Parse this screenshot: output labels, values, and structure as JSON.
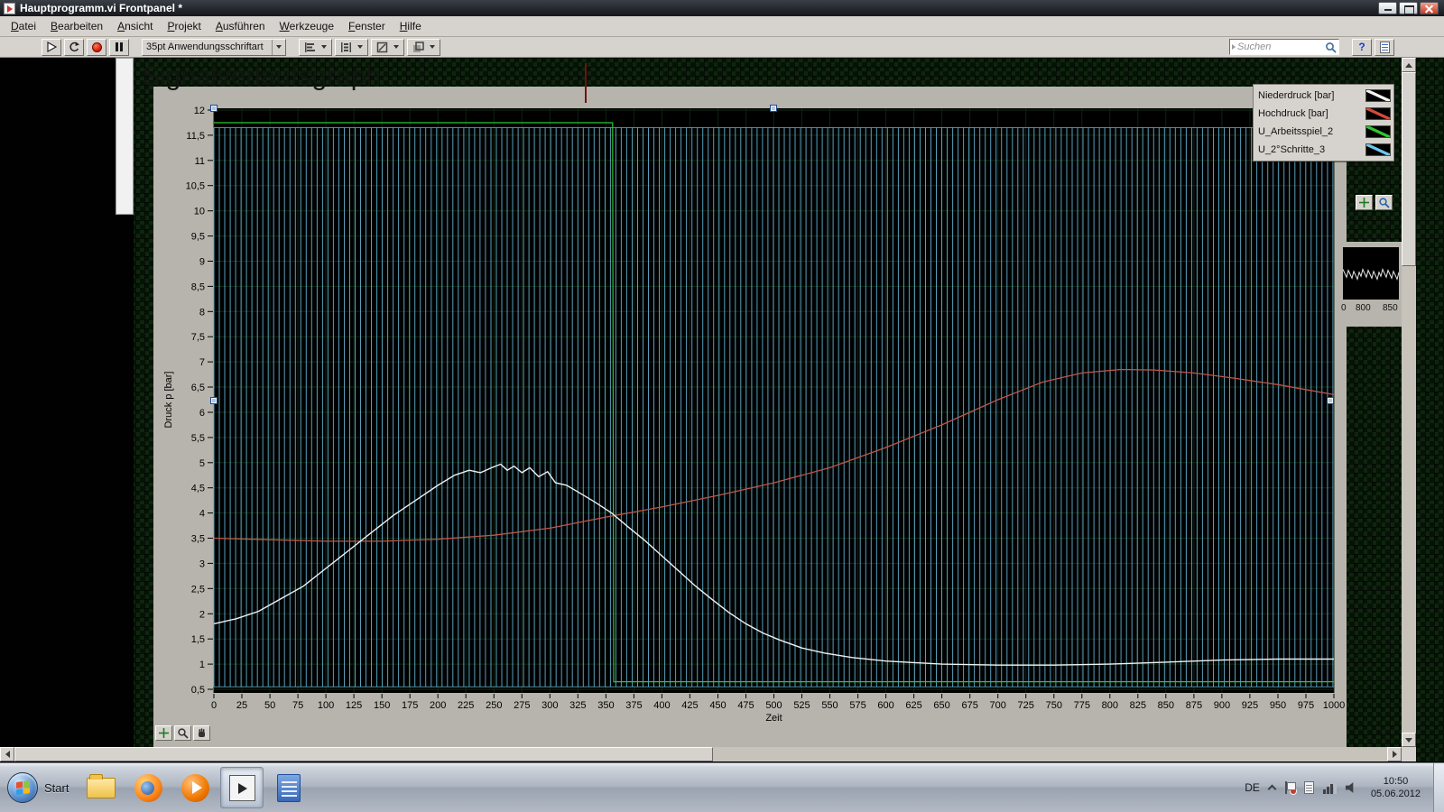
{
  "window": {
    "title": "Hauptprogramm.vi Frontpanel *"
  },
  "menu": {
    "items": [
      "Datei",
      "Bearbeiten",
      "Ansicht",
      "Projekt",
      "Ausführen",
      "Werkzeuge",
      "Fenster",
      "Hilfe"
    ]
  },
  "toolbar": {
    "font_selector": "35pt Anwendungsschriftart",
    "search_placeholder": "Suchen",
    "help_label": "?"
  },
  "graph": {
    "title": "Signalverlaufsgraph",
    "y_axis_label": "Druck p [bar]",
    "x_axis_label": "Zeit",
    "y_ticks": [
      "12",
      "11,5",
      "11",
      "10,5",
      "10",
      "9,5",
      "9",
      "8,5",
      "8",
      "7,5",
      "7",
      "6,5",
      "6",
      "5,5",
      "5",
      "4,5",
      "4",
      "3,5",
      "3",
      "2,5",
      "2",
      "1,5",
      "1",
      "0,5"
    ],
    "x_ticks": [
      "0",
      "25",
      "50",
      "75",
      "100",
      "125",
      "150",
      "175",
      "200",
      "225",
      "250",
      "275",
      "300",
      "325",
      "350",
      "375",
      "400",
      "425",
      "450",
      "475",
      "500",
      "525",
      "550",
      "575",
      "600",
      "625",
      "650",
      "675",
      "700",
      "725",
      "750",
      "775",
      "800",
      "825",
      "850",
      "875",
      "900",
      "925",
      "950",
      "975",
      "1000"
    ],
    "legend": [
      {
        "label": "Niederdruck [bar]",
        "color": "#f2f2f2"
      },
      {
        "label": "Hochdruck [bar]",
        "color": "#d04a3c"
      },
      {
        "label": "U_Arbeitsspiel_2",
        "color": "#2fc52f"
      },
      {
        "label": "U_2°Schritte_3",
        "color": "#6ec6e8"
      }
    ]
  },
  "chart_data": {
    "type": "line",
    "title": "Signalverlaufsgraph",
    "xlabel": "Zeit",
    "ylabel": "Druck p [bar]",
    "xlim": [
      0,
      1000
    ],
    "ylim": [
      0.5,
      12
    ],
    "x_tick_step": 25,
    "y_tick_step": 0.5,
    "grid": true,
    "legend_position": "top-right",
    "series": [
      {
        "name": "Niederdruck [bar]",
        "color": "#f2f2f2",
        "type": "line",
        "width": 1.4,
        "points": [
          [
            0,
            1.8
          ],
          [
            20,
            1.9
          ],
          [
            40,
            2.05
          ],
          [
            60,
            2.3
          ],
          [
            80,
            2.55
          ],
          [
            100,
            2.9
          ],
          [
            120,
            3.25
          ],
          [
            140,
            3.6
          ],
          [
            160,
            3.95
          ],
          [
            180,
            4.25
          ],
          [
            200,
            4.55
          ],
          [
            215,
            4.75
          ],
          [
            228,
            4.85
          ],
          [
            238,
            4.8
          ],
          [
            248,
            4.9
          ],
          [
            256,
            4.97
          ],
          [
            262,
            4.85
          ],
          [
            268,
            4.93
          ],
          [
            275,
            4.8
          ],
          [
            282,
            4.9
          ],
          [
            290,
            4.72
          ],
          [
            298,
            4.82
          ],
          [
            305,
            4.6
          ],
          [
            315,
            4.55
          ],
          [
            325,
            4.42
          ],
          [
            340,
            4.22
          ],
          [
            355,
            4.0
          ],
          [
            370,
            3.72
          ],
          [
            385,
            3.45
          ],
          [
            400,
            3.15
          ],
          [
            415,
            2.85
          ],
          [
            430,
            2.55
          ],
          [
            445,
            2.28
          ],
          [
            460,
            2.02
          ],
          [
            475,
            1.8
          ],
          [
            490,
            1.62
          ],
          [
            505,
            1.48
          ],
          [
            525,
            1.32
          ],
          [
            545,
            1.22
          ],
          [
            570,
            1.13
          ],
          [
            600,
            1.06
          ],
          [
            650,
            1.0
          ],
          [
            700,
            0.98
          ],
          [
            750,
            0.98
          ],
          [
            800,
            1.0
          ],
          [
            850,
            1.04
          ],
          [
            900,
            1.08
          ],
          [
            950,
            1.1
          ],
          [
            1000,
            1.1
          ]
        ]
      },
      {
        "name": "Hochdruck [bar]",
        "color": "#c0564a",
        "type": "line",
        "width": 1.3,
        "points": [
          [
            0,
            3.5
          ],
          [
            50,
            3.47
          ],
          [
            100,
            3.44
          ],
          [
            150,
            3.44
          ],
          [
            200,
            3.48
          ],
          [
            250,
            3.56
          ],
          [
            300,
            3.7
          ],
          [
            350,
            3.92
          ],
          [
            400,
            4.12
          ],
          [
            450,
            4.35
          ],
          [
            500,
            4.6
          ],
          [
            550,
            4.9
          ],
          [
            600,
            5.3
          ],
          [
            650,
            5.75
          ],
          [
            700,
            6.25
          ],
          [
            740,
            6.6
          ],
          [
            775,
            6.78
          ],
          [
            810,
            6.85
          ],
          [
            840,
            6.84
          ],
          [
            875,
            6.78
          ],
          [
            910,
            6.68
          ],
          [
            950,
            6.55
          ],
          [
            1000,
            6.35
          ]
        ]
      },
      {
        "name": "U_Arbeitsspiel_2",
        "color": "#2fc52f",
        "type": "line",
        "width": 1.2,
        "points": [
          [
            0,
            11.75
          ],
          [
            356,
            11.75
          ],
          [
            357,
            0.65
          ],
          [
            1000,
            0.65
          ]
        ]
      },
      {
        "name": "U_2°Schritte_3",
        "color": "#6ec6e8",
        "type": "square_wave",
        "low": 0.55,
        "high": 11.65,
        "period": 9.7,
        "x_start": 0,
        "x_end": 1000
      }
    ]
  },
  "side_graph": {
    "x_ticks": [
      "0",
      "800",
      "850"
    ]
  },
  "taskbar": {
    "start_label": "Start",
    "apps": [
      {
        "id": "folder"
      },
      {
        "id": "firefox"
      },
      {
        "id": "media-player"
      },
      {
        "id": "labview",
        "active": true
      },
      {
        "id": "notes"
      }
    ],
    "tray": {
      "language": "DE",
      "time": "10:50",
      "date": "05.06.2012"
    }
  }
}
